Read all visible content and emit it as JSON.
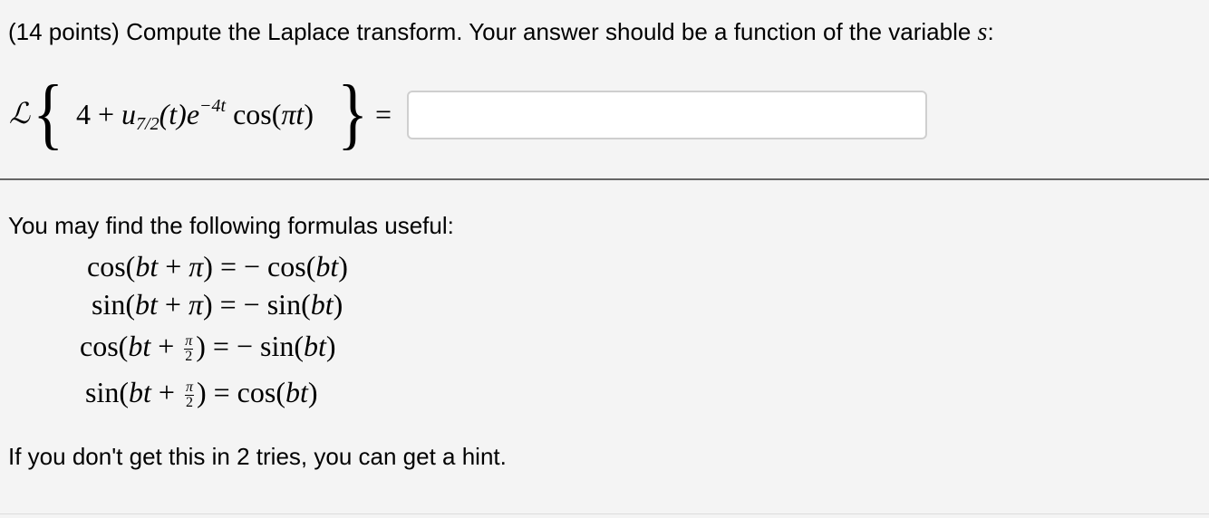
{
  "prompt": {
    "text": "(14 points) Compute the Laplace transform. Your answer should be a function of the variable ",
    "variable": "s",
    "suffix": ":"
  },
  "equation": {
    "operator": "ℒ",
    "left_brace": "{",
    "right_brace": "}",
    "term_const": "4",
    "plus": "+",
    "u": "u",
    "u_subscript": "7/2",
    "u_arg": "(t)",
    "exp_base": "e",
    "exp_power": "−4t",
    "cos_open": "cos(",
    "pi": "π",
    "t": "t",
    "cos_close": ")",
    "equals": "="
  },
  "answer": {
    "value": "",
    "placeholder": ""
  },
  "formulas": {
    "intro": "You may find the following formulas useful:",
    "items": [
      {
        "lhs_fn": "sin",
        "rhs": "= − sin(bt)"
      },
      {
        "lhs_fn": "cos",
        "rhs": "= − cos(bt)"
      }
    ],
    "f1": {
      "fn": "cos(",
      "bt": "bt",
      "plus": " + ",
      "shift": "π",
      "close": ")",
      "rhs_eq": " = − ",
      "rhs_fn": "cos(",
      "rhs_bt": "bt",
      "rhs_close": ")"
    },
    "f2": {
      "fn": "sin(",
      "bt": "bt",
      "plus": " + ",
      "shift": "π",
      "close": ")",
      "rhs_eq": " = − ",
      "rhs_fn": "sin(",
      "rhs_bt": "bt",
      "rhs_close": ")"
    },
    "f3": {
      "fn": "cos(",
      "bt": "bt",
      "plus": " + ",
      "frac_num": "π",
      "frac_den": "2",
      "close": ")",
      "rhs_eq": " = − ",
      "rhs_fn": "sin(",
      "rhs_bt": "bt",
      "rhs_close": ")"
    },
    "f4": {
      "fn": "sin(",
      "bt": "bt",
      "plus": " + ",
      "frac_num": "π",
      "frac_den": "2",
      "close": ")",
      "rhs_eq": " = ",
      "rhs_fn": "cos(",
      "rhs_bt": "bt",
      "rhs_close": ")"
    }
  },
  "hint": "If you don't get this in 2 tries, you can get a hint."
}
